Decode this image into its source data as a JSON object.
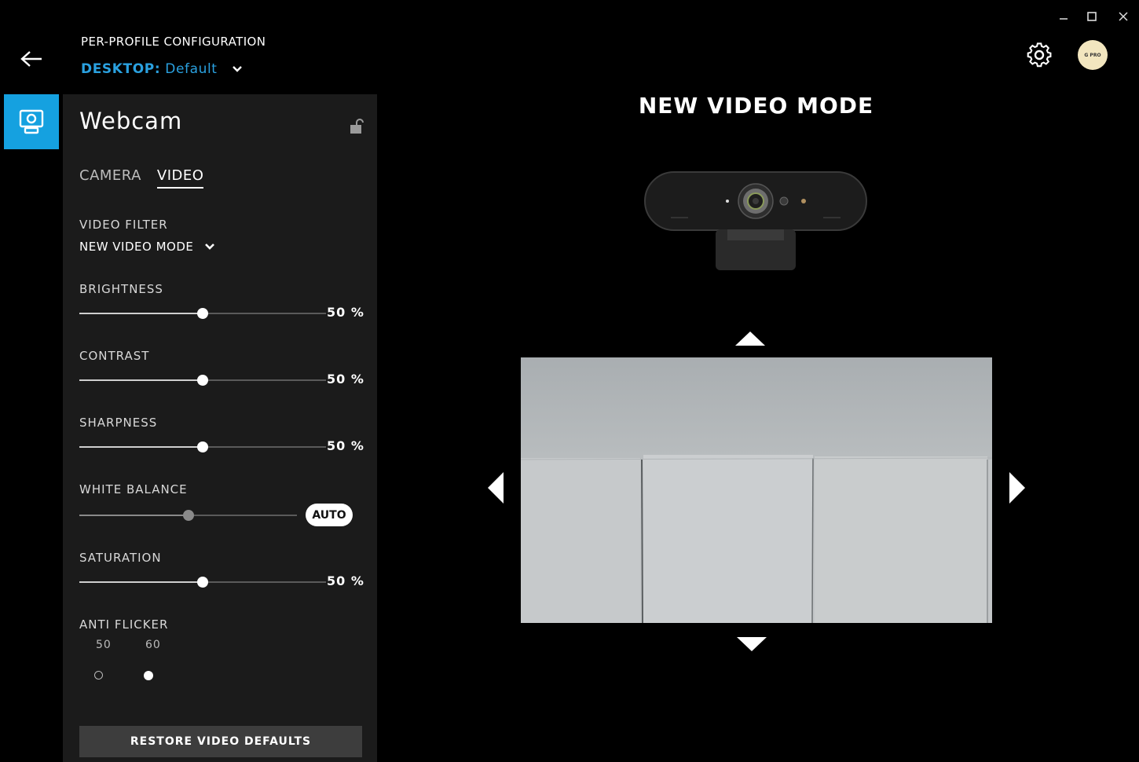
{
  "window": {
    "minimize": "–",
    "maximize": "□",
    "close": "✕"
  },
  "header": {
    "section": "PER-PROFILE CONFIGURATION",
    "profile_prefix": "DESKTOP:",
    "profile_name": "Default"
  },
  "avatar_text": "G PRO",
  "panel": {
    "title": "Webcam",
    "tabs": [
      {
        "label": "CAMERA",
        "active": false
      },
      {
        "label": "VIDEO",
        "active": true
      }
    ],
    "video_filter": {
      "label": "VIDEO FILTER",
      "value": "NEW VIDEO MODE"
    },
    "sliders": {
      "brightness": {
        "label": "BRIGHTNESS",
        "value": 50,
        "display": "50 %"
      },
      "contrast": {
        "label": "CONTRAST",
        "value": 50,
        "display": "50 %"
      },
      "sharpness": {
        "label": "SHARPNESS",
        "value": 50,
        "display": "50 %"
      },
      "white_balance": {
        "label": "WHITE BALANCE",
        "value": 50,
        "auto_label": "AUTO",
        "auto": true
      },
      "saturation": {
        "label": "SATURATION",
        "value": 50,
        "display": "50 %"
      }
    },
    "anti_flicker": {
      "label": "ANTI FLICKER",
      "options": [
        {
          "label": "50",
          "selected": false
        },
        {
          "label": "60",
          "selected": true
        }
      ]
    },
    "restore_label": "RESTORE VIDEO DEFAULTS"
  },
  "preview": {
    "title": "NEW VIDEO MODE"
  },
  "colors": {
    "accent": "#15a1e0",
    "panel": "#1b1b1b",
    "background": "#000000"
  }
}
